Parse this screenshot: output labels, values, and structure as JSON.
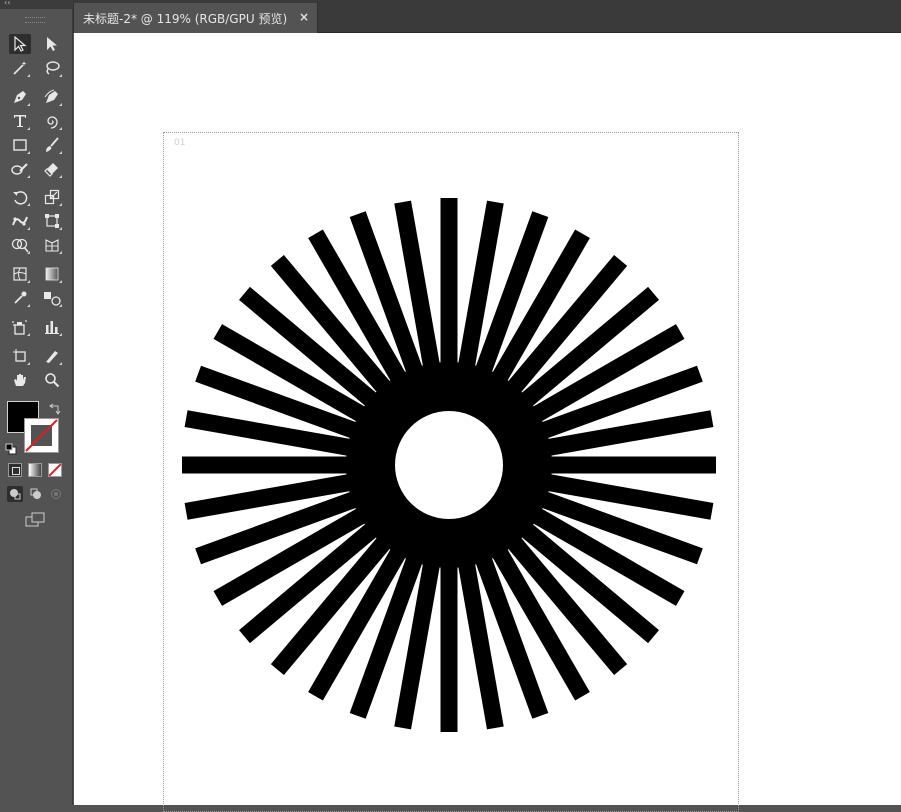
{
  "document": {
    "tab_title": "未标题-2* @ 119% (RGB/GPU 预览)",
    "close_glyph": "×"
  },
  "toolbar": {
    "collapse_glyph": "‹‹",
    "tools": [
      {
        "name": "selection-tool-icon",
        "active": true
      },
      {
        "name": "direct-selection-tool-icon"
      },
      {
        "name": "magic-wand-tool-icon"
      },
      {
        "name": "lasso-tool-icon"
      },
      {
        "name": "pen-tool-icon"
      },
      {
        "name": "curvature-tool-icon"
      },
      {
        "name": "type-tool-icon"
      },
      {
        "name": "spiral-tool-icon"
      },
      {
        "name": "rectangle-tool-icon"
      },
      {
        "name": "paintbrush-tool-icon"
      },
      {
        "name": "shaper-tool-icon"
      },
      {
        "name": "eraser-tool-icon"
      },
      {
        "name": "rotate-tool-icon"
      },
      {
        "name": "scale-tool-icon"
      },
      {
        "name": "puppet-warp-tool-icon"
      },
      {
        "name": "free-transform-tool-icon"
      },
      {
        "name": "shape-builder-tool-icon"
      },
      {
        "name": "perspective-grid-tool-icon"
      },
      {
        "name": "mesh-tool-icon"
      },
      {
        "name": "gradient-tool-icon"
      },
      {
        "name": "eyedropper-tool-icon"
      },
      {
        "name": "blend-tool-icon"
      },
      {
        "name": "symbol-sprayer-tool-icon"
      },
      {
        "name": "column-graph-tool-icon"
      },
      {
        "name": "artboard-tool-icon"
      },
      {
        "name": "slice-tool-icon"
      },
      {
        "name": "hand-tool-icon"
      },
      {
        "name": "zoom-tool-icon"
      }
    ],
    "fill_color": "#000000",
    "stroke_color": "none"
  },
  "artwork": {
    "shape": "starburst",
    "ray_count": 36,
    "fill": "#000000",
    "center_fill": "#ffffff"
  },
  "colors": {
    "panel_bg": "#535353",
    "tab_bar_bg": "#3a3a3a",
    "canvas_bg": "#ffffff"
  }
}
